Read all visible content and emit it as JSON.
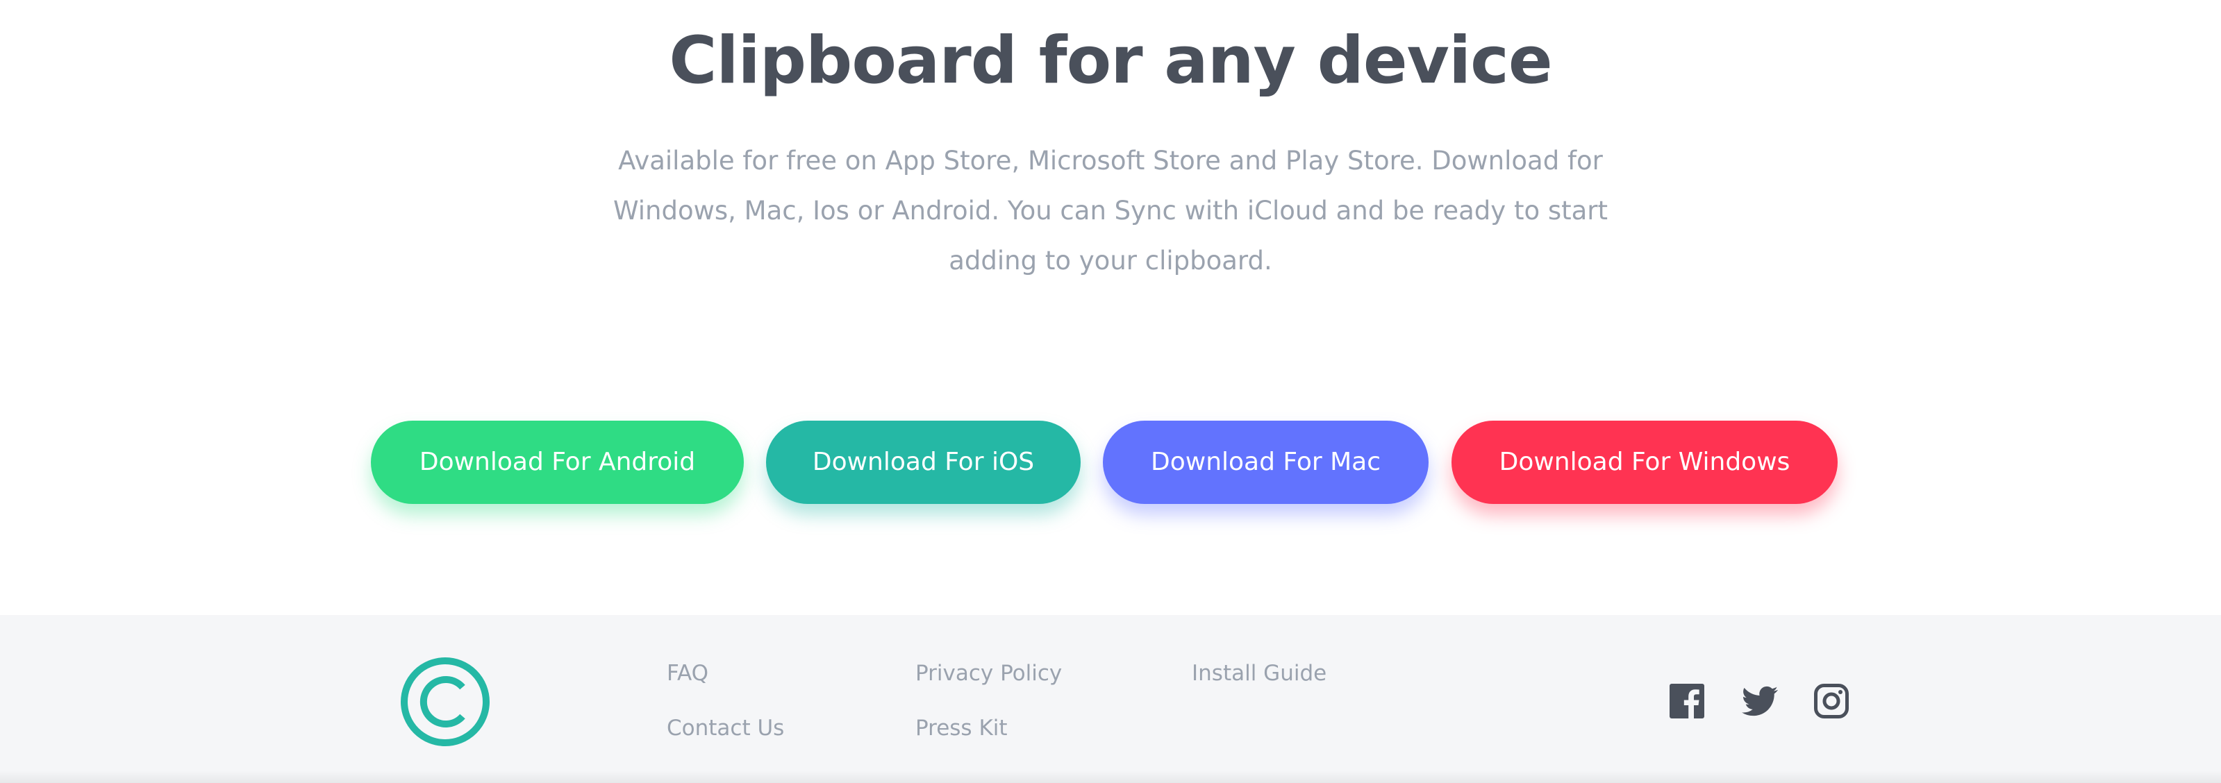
{
  "hero": {
    "title": "Clipboard for any device",
    "description_lines": [
      "Available for free on App Store, Microsoft Store and Play Store. Download for",
      "Windows, Mac, Ios or Android. You can Sync with iCloud and be ready to start",
      "adding to your clipboard."
    ]
  },
  "downloads": {
    "android": {
      "label": "Download For Android",
      "color": "#2fdc84"
    },
    "ios": {
      "label": "Download For iOS",
      "color": "#25b8a5"
    },
    "mac": {
      "label": "Download For Mac",
      "color": "#6273fe"
    },
    "windows": {
      "label": "Download For Windows",
      "color": "#ff3352"
    }
  },
  "footer": {
    "logo_icon": "clipboard-logo-icon",
    "logo_color": "#25b8a5",
    "links": {
      "faq": "FAQ",
      "contact": "Contact Us",
      "privacy": "Privacy Policy",
      "press": "Press Kit",
      "install": "Install Guide"
    },
    "social": [
      "facebook-icon",
      "twitter-icon",
      "instagram-icon"
    ],
    "icon_color": "#4a505b"
  }
}
